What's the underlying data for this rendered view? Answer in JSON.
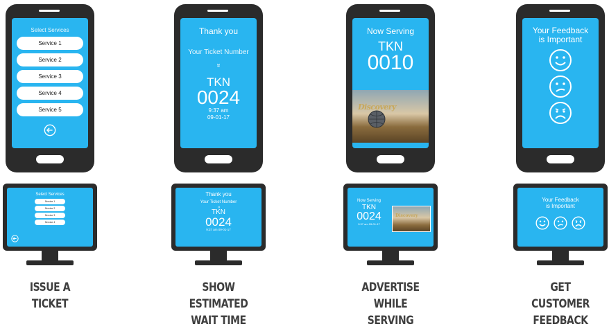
{
  "columns": [
    {
      "caption": "ISSUE A TICKET",
      "phone": {
        "title": "Select Services",
        "services": [
          "Service 1",
          "Service 2",
          "Service 3",
          "Service 4",
          "Service 5"
        ],
        "icon": "back-arrow-icon"
      },
      "monitor": {
        "title": "Select Services",
        "services": [
          "Service 1",
          "Service 2",
          "Service 3",
          "Service 4"
        ],
        "icon": "back-arrow-icon"
      }
    },
    {
      "caption": "SHOW ESTIMATED WAIT TIME",
      "phone": {
        "thanks": "Thank you",
        "ticket_label": "Your Ticket Number",
        "chevron": "»",
        "prefix": "TKN",
        "number": "0024",
        "time": "9:37 am",
        "date": "09-01-17"
      },
      "monitor": {
        "thanks": "Thank you",
        "ticket_label": "Your Ticket Number",
        "chevron": "»",
        "prefix": "TKN",
        "number": "0024",
        "time_date": "9:37 am  09-01-17"
      }
    },
    {
      "caption": "ADVERTISE WHILE SERVING",
      "phone": {
        "title": "Now Serving",
        "prefix": "TKN",
        "number": "0010",
        "ad_logo": "Discovery"
      },
      "monitor": {
        "title": "Now Serving",
        "prefix": "TKN",
        "number": "0024",
        "time_date": "9:37 am  09-01-17",
        "ad_logo": "Discovery"
      }
    },
    {
      "caption": "GET CUSTOMER FEEDBACK",
      "phone": {
        "title_line1": "Your Feedback",
        "title_line2": "is Important",
        "faces": [
          "happy-face-icon",
          "neutral-sad-face-icon",
          "sad-face-icon"
        ]
      },
      "monitor": {
        "title_line1": "Your Feedback",
        "title_line2": "is Important",
        "faces": [
          "happy-face-icon",
          "neutral-sad-face-icon",
          "sad-face-icon"
        ]
      }
    }
  ],
  "colors": {
    "screen": "#29b5f0",
    "device": "#2b2b2b",
    "caption": "#3f3f3f"
  }
}
